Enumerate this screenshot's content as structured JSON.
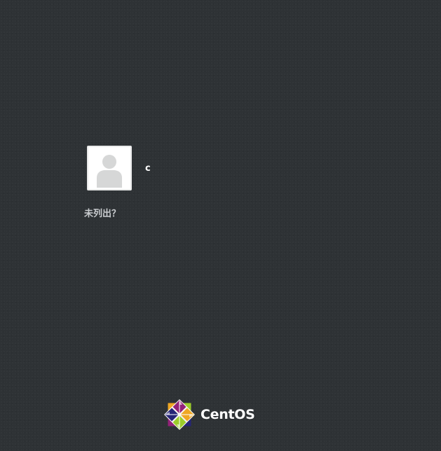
{
  "user_list": {
    "users": [
      {
        "name": "c",
        "avatar_icon": "user-silhouette-icon"
      }
    ],
    "not_listed_label": "未列出？"
  },
  "branding": {
    "logo_icon": "centos-logo-icon",
    "name": "CentOS"
  },
  "colors": {
    "background": "#2e3235",
    "avatar_border": "#e9eaea",
    "text": "#ffffff",
    "link_text": "#c9cccf"
  }
}
